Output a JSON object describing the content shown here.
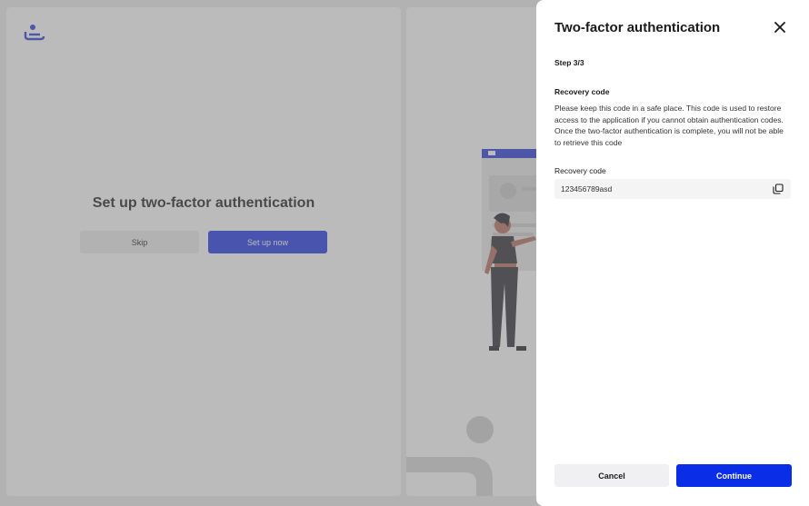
{
  "background": {
    "setup_title": "Set up two-factor authentication",
    "skip_label": "Skip",
    "setup_now_label": "Set up now"
  },
  "panel": {
    "title": "Two-factor authentication",
    "close_icon": "close-icon",
    "step": "Step 3/3",
    "section_title": "Recovery code",
    "description": "Please keep this code in a safe place. This code is used to restore access to the application if you cannot obtain authentication codes. Once the two-factor authentication is complete, you will not be able to retrieve this code",
    "code_label": "Recovery code",
    "code_value": "123456789asd",
    "copy_icon": "copy-icon",
    "cancel_label": "Cancel",
    "continue_label": "Continue"
  },
  "colors": {
    "accent": "#0a2ee8",
    "overlay": "rgba(120,120,120,0.5)"
  }
}
